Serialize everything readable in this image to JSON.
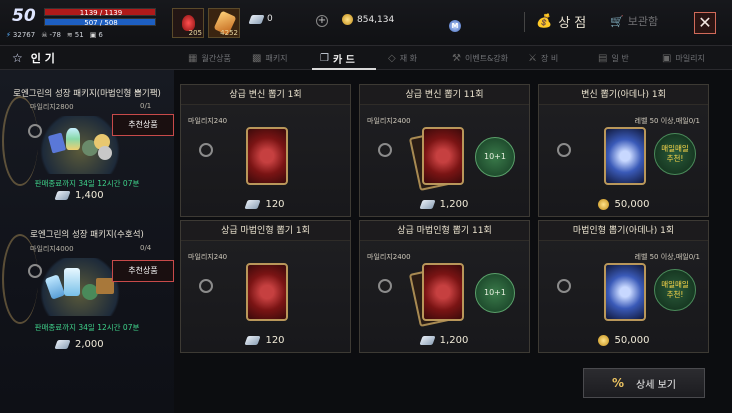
{
  "player": {
    "level": "50",
    "hp": "1139 / 1139",
    "mp": "507 / 508",
    "stats": [
      {
        "icon": "lightning-icon",
        "value": "32767"
      },
      {
        "icon": "skull-icon",
        "value": "-78"
      },
      {
        "icon": "wing-icon",
        "value": "51"
      },
      {
        "icon": "book-icon",
        "value": "6"
      }
    ]
  },
  "quickslots": [
    {
      "icon": "potion-icon",
      "count": "205"
    },
    {
      "icon": "scroll-icon",
      "count": "4252"
    }
  ],
  "currency": {
    "diamond": "0",
    "adena": "854,134",
    "m_coin_icon": "M"
  },
  "header": {
    "shop_title": "상 점",
    "storage_label": "보관함",
    "close_symbol": "✕"
  },
  "tabs": {
    "popular": "인 기",
    "items": [
      {
        "label": "월간상품"
      },
      {
        "label": "패키지"
      },
      {
        "label": "카 드"
      },
      {
        "label": "재 화"
      },
      {
        "label": "이벤트&강화"
      },
      {
        "label": "장 비"
      },
      {
        "label": "일 반"
      },
      {
        "label": "마일리지"
      }
    ]
  },
  "packages": [
    {
      "title": "로엔그린의 성장 패키지(마법인형 뽑기팩)",
      "mileage": "마일리지2800",
      "limit": "0/1",
      "badge": "추천상품",
      "end": "판매종료까지 34일 12시간 07분",
      "price": "1,400"
    },
    {
      "title": "로엔그린의 성장 패키지(수호석)",
      "mileage": "마일리지4000",
      "limit": "0/4",
      "badge": "추천상품",
      "end": "판매종료까지 34일 12시간 07분",
      "price": "2,000"
    }
  ],
  "cards": [
    {
      "title": "상급 변신 뽑기 1회",
      "mileage": "마일리지240",
      "level": "",
      "price": "120",
      "bonus": "",
      "daily": ""
    },
    {
      "title": "상급 변신 뽑기 11회",
      "mileage": "마일리지2400",
      "level": "",
      "price": "1,200",
      "bonus": "10+1",
      "daily": ""
    },
    {
      "title": "변신 뽑기(아데나) 1회",
      "mileage": "",
      "level": "레벨 50 이상,매일0/1",
      "price": "50,000",
      "bonus": "",
      "daily": "매일매일 추천!"
    },
    {
      "title": "상급 마법인형 뽑기 1회",
      "mileage": "마일리지240",
      "level": "",
      "price": "120",
      "bonus": "",
      "daily": ""
    },
    {
      "title": "상급 마법인형 뽑기 11회",
      "mileage": "마일리지2400",
      "level": "",
      "price": "1,200",
      "bonus": "10+1",
      "daily": ""
    },
    {
      "title": "마법인형 뽑기(아데나) 1회",
      "mileage": "",
      "level": "레벨 50 이상,매일0/1",
      "price": "50,000",
      "bonus": "",
      "daily": "매일매일 추천!"
    }
  ],
  "footer": {
    "detail_label": "상세 보기",
    "detail_icon": "%"
  }
}
